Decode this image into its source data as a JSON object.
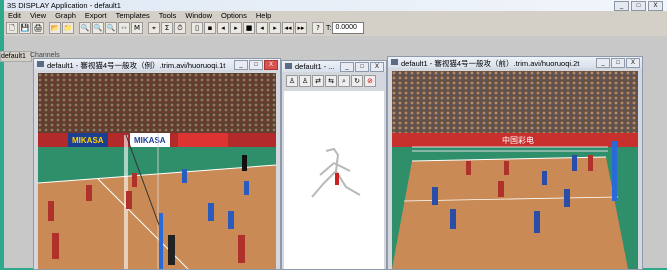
{
  "app": {
    "title": "3S DISPLAY Application - default1",
    "window_buttons": [
      "_",
      "□",
      "X"
    ]
  },
  "menu": [
    "Edit",
    "View",
    "Graph",
    "Export",
    "Templates",
    "Tools",
    "Window",
    "Options",
    "Help"
  ],
  "toolbar": {
    "buttons": [
      "🗋",
      "💾",
      "🖨",
      "📂",
      "📁",
      "🔍",
      "🔍",
      "🔍",
      "↔",
      "M",
      "⌖",
      "Σ",
      "⏱",
      "▯",
      "▪",
      "◂",
      "▸",
      "■",
      "◂",
      "▸",
      "◂◂",
      "▸▸",
      "?"
    ],
    "time_label": "T:",
    "time_value": "0.0000"
  },
  "mdi": {
    "doc_tab": "default1",
    "panel_tab": "Channels"
  },
  "windows": {
    "left": {
      "title": "default1 - 審视猫4号一般攻（例）.trim.avi/huoruoqi.1t",
      "buttons": [
        "_",
        "□",
        "X"
      ]
    },
    "mid": {
      "title": "default1 - ...",
      "buttons": [
        "_",
        "□",
        "X"
      ],
      "tools": [
        "♙",
        "♙",
        "⇄",
        "⇆",
        "⌕",
        "↻",
        "⊘"
      ]
    },
    "right": {
      "title": "default1 - 審视猫4号一般攻（前）.trim.avi/huoruoqi.2t",
      "buttons": [
        "_",
        "□",
        "X"
      ]
    }
  },
  "video": {
    "left": {
      "banner_left": "MIKASA",
      "banner_mid": "MIKASA"
    },
    "right": {
      "banner": "中国彩电"
    }
  },
  "colors": {
    "desktop": "#2fa98c",
    "chrome": "#d4d0c8",
    "court": "#c98a55",
    "court_outer": "#2e8f6a",
    "stands": "#5a4030"
  }
}
